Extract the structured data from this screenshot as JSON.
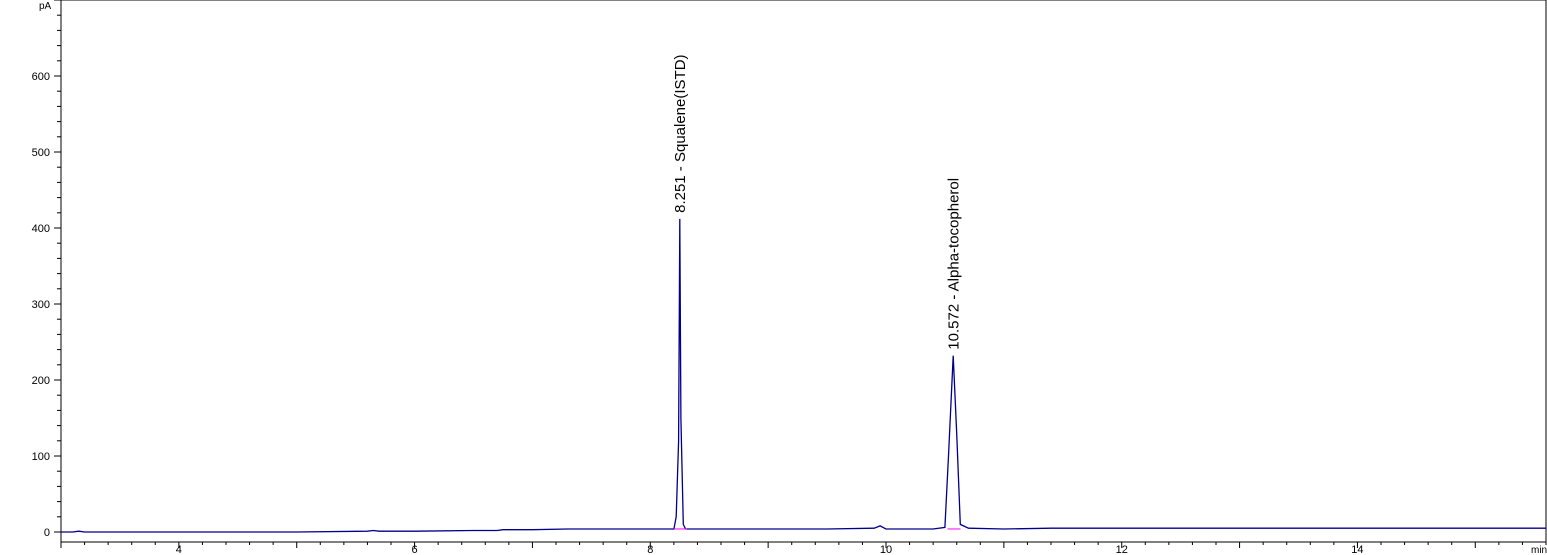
{
  "chart_data": {
    "type": "line",
    "y_unit": "pA",
    "x_unit": "min",
    "xlim": [
      3.0,
      15.6
    ],
    "ylim": [
      0,
      700
    ],
    "x_ticks": [
      4,
      6,
      8,
      10,
      12,
      14
    ],
    "y_ticks": [
      0,
      100,
      200,
      300,
      400,
      500,
      600
    ],
    "grid": false,
    "colors": {
      "signal": "#00008B",
      "baseline_mark": "#FF00FF",
      "axis": "#000000"
    },
    "series": [
      {
        "x": [
          3.0,
          3.1,
          3.15,
          3.2,
          3.5,
          4.0,
          5.0,
          5.6,
          5.65,
          5.7,
          6.0,
          6.5,
          6.7,
          6.75,
          7.0,
          7.3,
          7.5,
          8.0,
          8.2,
          8.22,
          8.24,
          8.25,
          8.26,
          8.28,
          8.3,
          8.5,
          9.0,
          9.5,
          9.9,
          9.95,
          10.0,
          10.4,
          10.5,
          10.53,
          10.57,
          10.6,
          10.63,
          10.7,
          11.0,
          11.4,
          12.0,
          13.0,
          14.0,
          15.0,
          15.6
        ],
        "y": [
          0,
          0,
          1,
          0,
          0,
          0,
          0,
          1,
          2,
          1,
          1,
          2,
          2,
          3,
          3,
          4,
          4,
          4,
          4,
          20,
          120,
          412,
          150,
          10,
          4,
          4,
          4,
          4,
          5,
          8,
          4,
          4,
          6,
          100,
          232,
          130,
          10,
          5,
          4,
          5,
          5,
          5,
          5,
          5,
          5
        ]
      }
    ],
    "annotations": [
      {
        "x": 8.251,
        "y": 412,
        "label": "8.251 -  Squalene(ISTD)"
      },
      {
        "x": 10.572,
        "y": 232,
        "label": "10.572 -  Alpha-tocopherol"
      }
    ]
  }
}
